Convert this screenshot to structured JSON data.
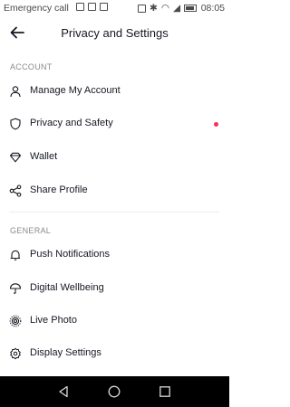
{
  "status_bar": {
    "carrier": "Emergency call",
    "time": "08:05"
  },
  "header": {
    "title": "Privacy and Settings"
  },
  "sections": {
    "account": {
      "title": "ACCOUNT",
      "items": [
        {
          "label": "Manage My Account",
          "icon": "person-icon"
        },
        {
          "label": "Privacy and Safety",
          "icon": "shield-icon",
          "has_notification_dot": true
        },
        {
          "label": "Wallet",
          "icon": "diamond-icon"
        },
        {
          "label": "Share Profile",
          "icon": "share-icon"
        }
      ]
    },
    "general": {
      "title": "GENERAL",
      "items": [
        {
          "label": "Push Notifications",
          "icon": "bell-icon"
        },
        {
          "label": "Digital Wellbeing",
          "icon": "umbrella-icon"
        },
        {
          "label": "Live Photo",
          "icon": "live-photo-icon"
        },
        {
          "label": "Display Settings",
          "icon": "gear-icon"
        }
      ]
    }
  },
  "colors": {
    "accent_dot": "#fe2c55",
    "text": "#161823",
    "secondary": "#8a8b91"
  }
}
